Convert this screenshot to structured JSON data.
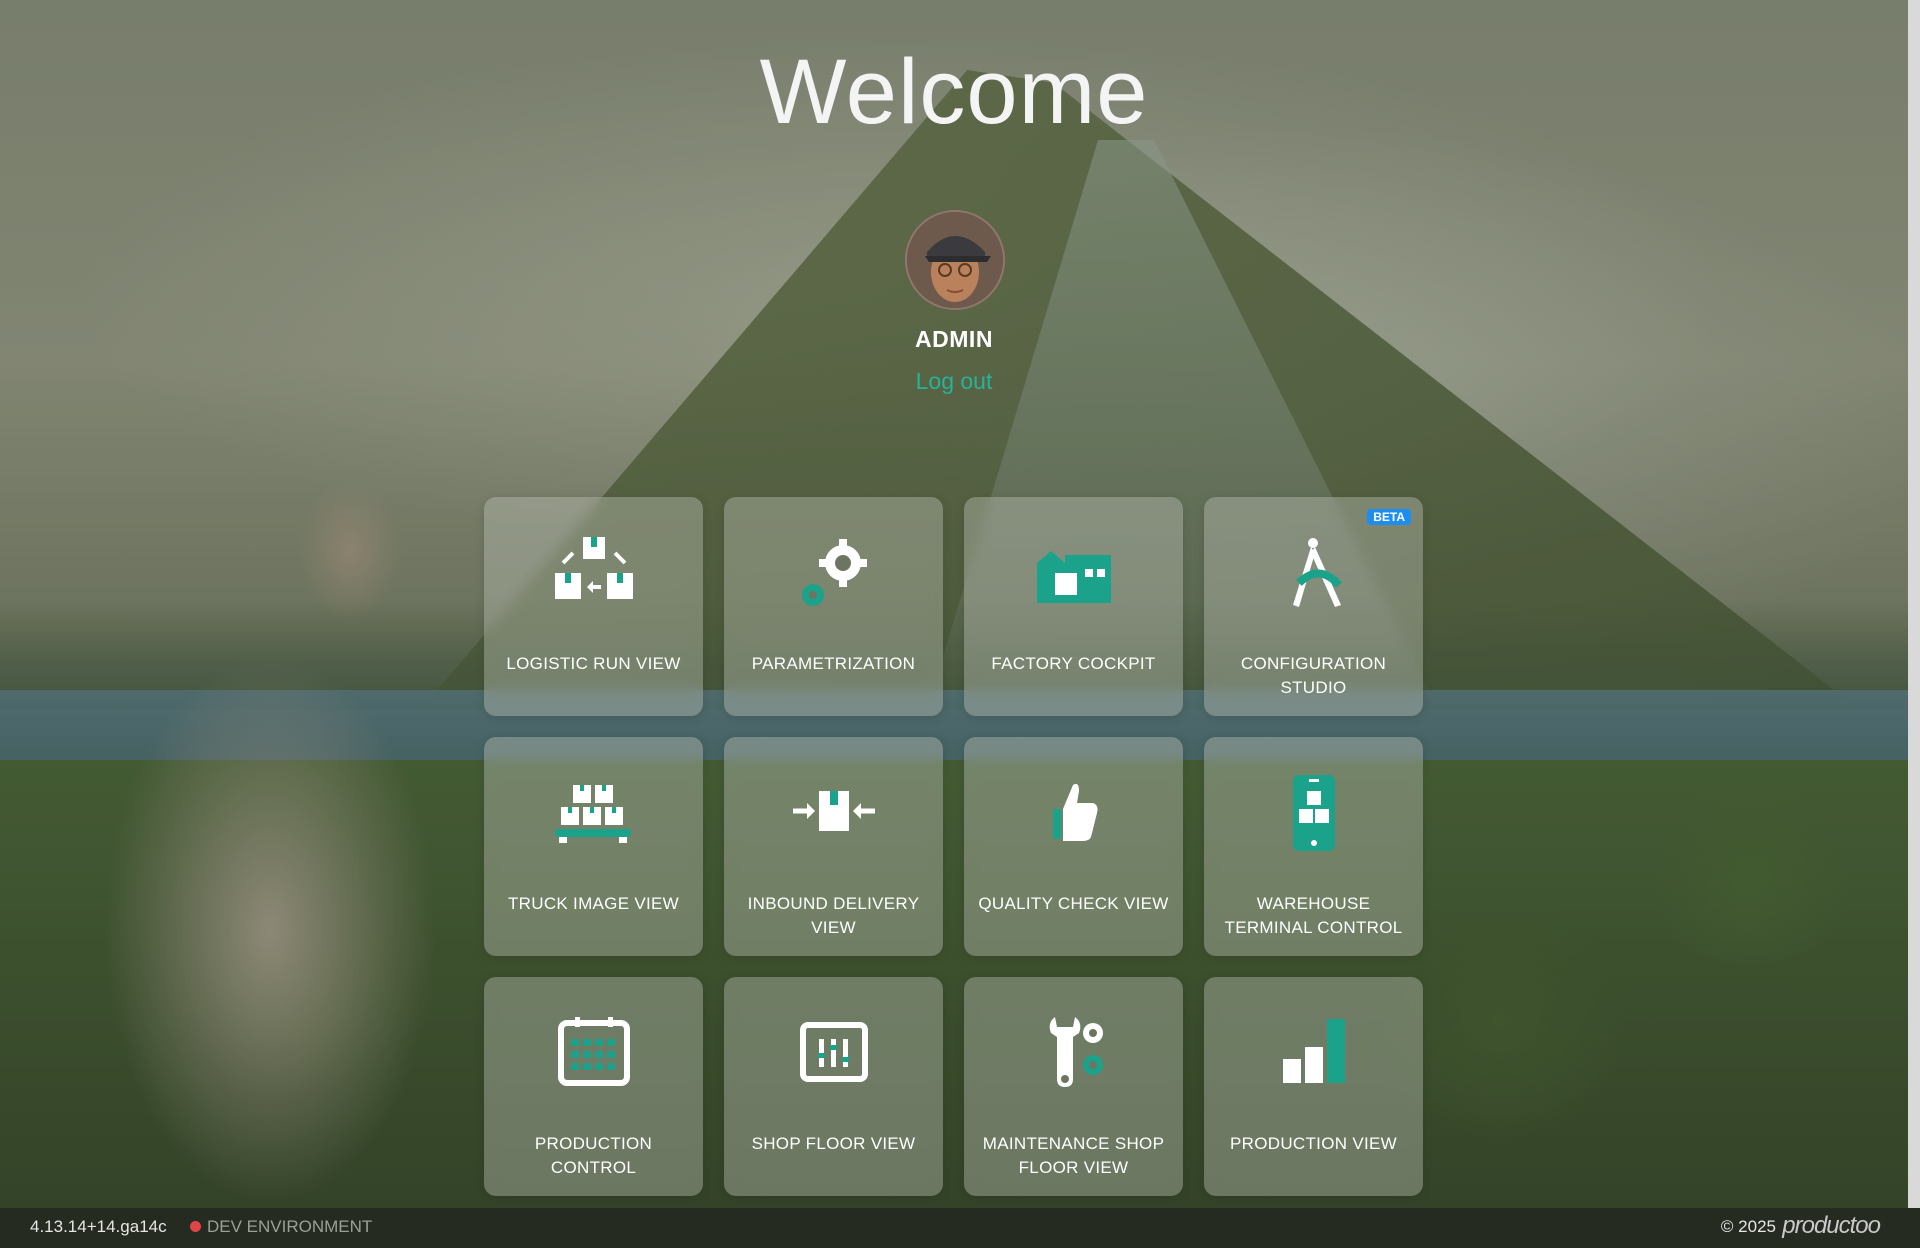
{
  "header": {
    "title": "Welcome"
  },
  "user": {
    "name": "ADMIN",
    "logout_label": "Log out"
  },
  "tiles": [
    {
      "label": "LOGISTIC RUN VIEW",
      "icon": "boxes-flow-icon"
    },
    {
      "label": "PARAMETRIZATION",
      "icon": "gears-icon"
    },
    {
      "label": "FACTORY COCKPIT",
      "icon": "factory-icon"
    },
    {
      "label": "CONFIGURATION STUDIO",
      "icon": "compass-icon",
      "badge": "BETA"
    },
    {
      "label": "TRUCK IMAGE VIEW",
      "icon": "pallet-boxes-icon"
    },
    {
      "label": "INBOUND DELIVERY VIEW",
      "icon": "inbound-box-icon"
    },
    {
      "label": "QUALITY CHECK VIEW",
      "icon": "thumbs-up-icon"
    },
    {
      "label": "WAREHOUSE TERMINAL CONTROL",
      "icon": "terminal-boxes-icon"
    },
    {
      "label": "PRODUCTION CONTROL",
      "icon": "calendar-icon"
    },
    {
      "label": "SHOP FLOOR VIEW",
      "icon": "control-panel-icon"
    },
    {
      "label": "MAINTENANCE SHOP FLOOR VIEW",
      "icon": "wrench-gear-icon"
    },
    {
      "label": "PRODUCTION VIEW",
      "icon": "bar-chart-icon"
    }
  ],
  "footer": {
    "version": "4.13.14+14.ga14c",
    "environment": "DEV ENVIRONMENT",
    "copyright": "© 2025",
    "brand": "productoo"
  },
  "colors": {
    "accent": "#27b29b",
    "icon_teal": "#1aa28a",
    "badge_blue": "#1d8ef0",
    "env_dot": "#e04545"
  }
}
